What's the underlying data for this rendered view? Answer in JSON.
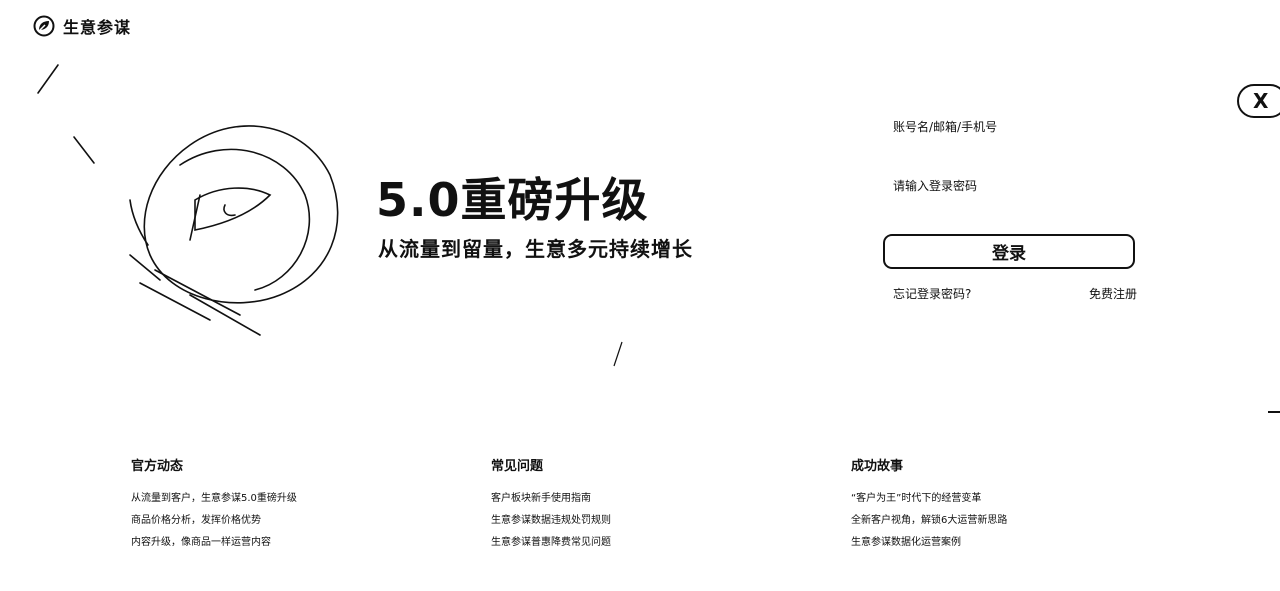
{
  "brand": {
    "name": "生意参谋",
    "icon": "leaf-logo-icon"
  },
  "close": {
    "label": "X",
    "icon": "close-icon"
  },
  "hero": {
    "title": "5.0重磅升级",
    "subtitle": "从流量到留量，生意多元持续增长"
  },
  "login": {
    "username_placeholder": "账号名/邮箱/手机号",
    "password_placeholder": "请输入登录密码",
    "submit_label": "登录",
    "forgot_label": "忘记登录密码?",
    "register_label": "免费注册"
  },
  "footer": {
    "columns": [
      {
        "title": "官方动态",
        "items": [
          "从流量到客户，生意参谋5.0重磅升级",
          "商品价格分析，发挥价格优势",
          "内容升级，像商品一样运营内容"
        ]
      },
      {
        "title": "常见问题",
        "items": [
          "客户板块新手使用指南",
          "生意参谋数据违规处罚规则",
          "生意参谋普惠降费常见问题"
        ]
      },
      {
        "title": "成功故事",
        "items": [
          "“客户为王”时代下的经营变革",
          "全新客户视角，解锁6大运营新思路",
          "生意参谋数据化运营案例"
        ]
      }
    ]
  }
}
